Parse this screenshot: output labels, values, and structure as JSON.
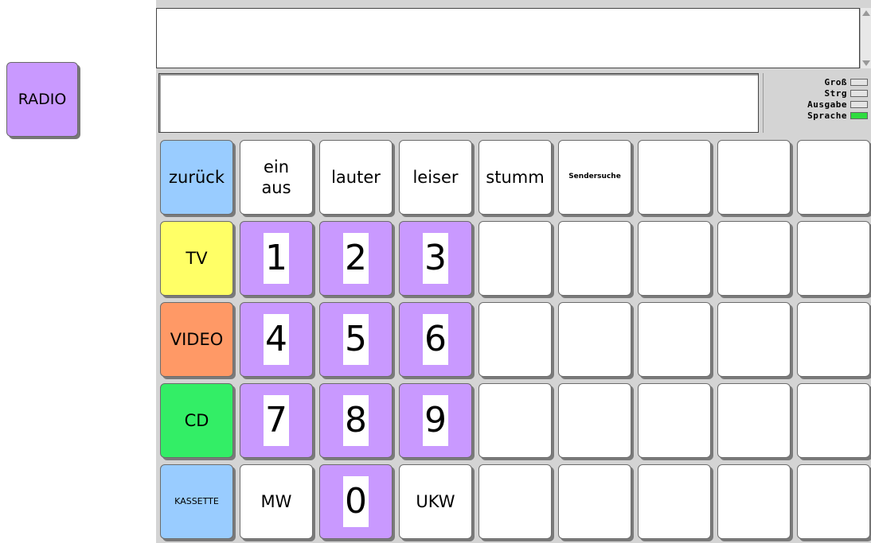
{
  "side_button": {
    "label": "RADIO",
    "color": "#c999ff"
  },
  "status": [
    {
      "label": "Groß",
      "on": false
    },
    {
      "label": "Strg",
      "on": false
    },
    {
      "label": "Ausgabe",
      "on": false
    },
    {
      "label": "Sprache",
      "on": true
    }
  ],
  "keys": [
    {
      "name": "zurueck",
      "label": "zurück",
      "color": "blue"
    },
    {
      "name": "ein-aus",
      "label": "ein\naus",
      "color": "white",
      "two": true
    },
    {
      "name": "lauter",
      "label": "lauter",
      "color": "white"
    },
    {
      "name": "leiser",
      "label": "leiser",
      "color": "white"
    },
    {
      "name": "stumm",
      "label": "stumm",
      "color": "white"
    },
    {
      "name": "sendersuche",
      "label": "Sendersuche",
      "color": "white",
      "size": "tiny"
    },
    {
      "name": "empty",
      "label": "",
      "color": "white"
    },
    {
      "name": "empty",
      "label": "",
      "color": "white"
    },
    {
      "name": "empty",
      "label": "",
      "color": "white"
    },
    {
      "name": "tv",
      "label": "TV",
      "color": "yellow"
    },
    {
      "name": "digit-1",
      "label": "1",
      "color": "purple",
      "num": true
    },
    {
      "name": "digit-2",
      "label": "2",
      "color": "purple",
      "num": true
    },
    {
      "name": "digit-3",
      "label": "3",
      "color": "purple",
      "num": true
    },
    {
      "name": "empty",
      "label": "",
      "color": "white"
    },
    {
      "name": "empty",
      "label": "",
      "color": "white"
    },
    {
      "name": "empty",
      "label": "",
      "color": "white"
    },
    {
      "name": "empty",
      "label": "",
      "color": "white"
    },
    {
      "name": "empty",
      "label": "",
      "color": "white"
    },
    {
      "name": "video",
      "label": "VIDEO",
      "color": "orange"
    },
    {
      "name": "digit-4",
      "label": "4",
      "color": "purple",
      "num": true
    },
    {
      "name": "digit-5",
      "label": "5",
      "color": "purple",
      "num": true
    },
    {
      "name": "digit-6",
      "label": "6",
      "color": "purple",
      "num": true
    },
    {
      "name": "empty",
      "label": "",
      "color": "white"
    },
    {
      "name": "empty",
      "label": "",
      "color": "white"
    },
    {
      "name": "empty",
      "label": "",
      "color": "white"
    },
    {
      "name": "empty",
      "label": "",
      "color": "white"
    },
    {
      "name": "empty",
      "label": "",
      "color": "white"
    },
    {
      "name": "cd",
      "label": "CD",
      "color": "green"
    },
    {
      "name": "digit-7",
      "label": "7",
      "color": "purple",
      "num": true
    },
    {
      "name": "digit-8",
      "label": "8",
      "color": "purple",
      "num": true
    },
    {
      "name": "digit-9",
      "label": "9",
      "color": "purple",
      "num": true
    },
    {
      "name": "empty",
      "label": "",
      "color": "white"
    },
    {
      "name": "empty",
      "label": "",
      "color": "white"
    },
    {
      "name": "empty",
      "label": "",
      "color": "white"
    },
    {
      "name": "empty",
      "label": "",
      "color": "white"
    },
    {
      "name": "empty",
      "label": "",
      "color": "white"
    },
    {
      "name": "kassette",
      "label": "KASSETTE",
      "color": "blue",
      "size": "small"
    },
    {
      "name": "mw",
      "label": "MW",
      "color": "white"
    },
    {
      "name": "digit-0",
      "label": "0",
      "color": "purple",
      "num": true
    },
    {
      "name": "ukw",
      "label": "UKW",
      "color": "white"
    },
    {
      "name": "empty",
      "label": "",
      "color": "white"
    },
    {
      "name": "empty",
      "label": "",
      "color": "white"
    },
    {
      "name": "empty",
      "label": "",
      "color": "white"
    },
    {
      "name": "empty",
      "label": "",
      "color": "white"
    },
    {
      "name": "empty",
      "label": "",
      "color": "white"
    }
  ]
}
